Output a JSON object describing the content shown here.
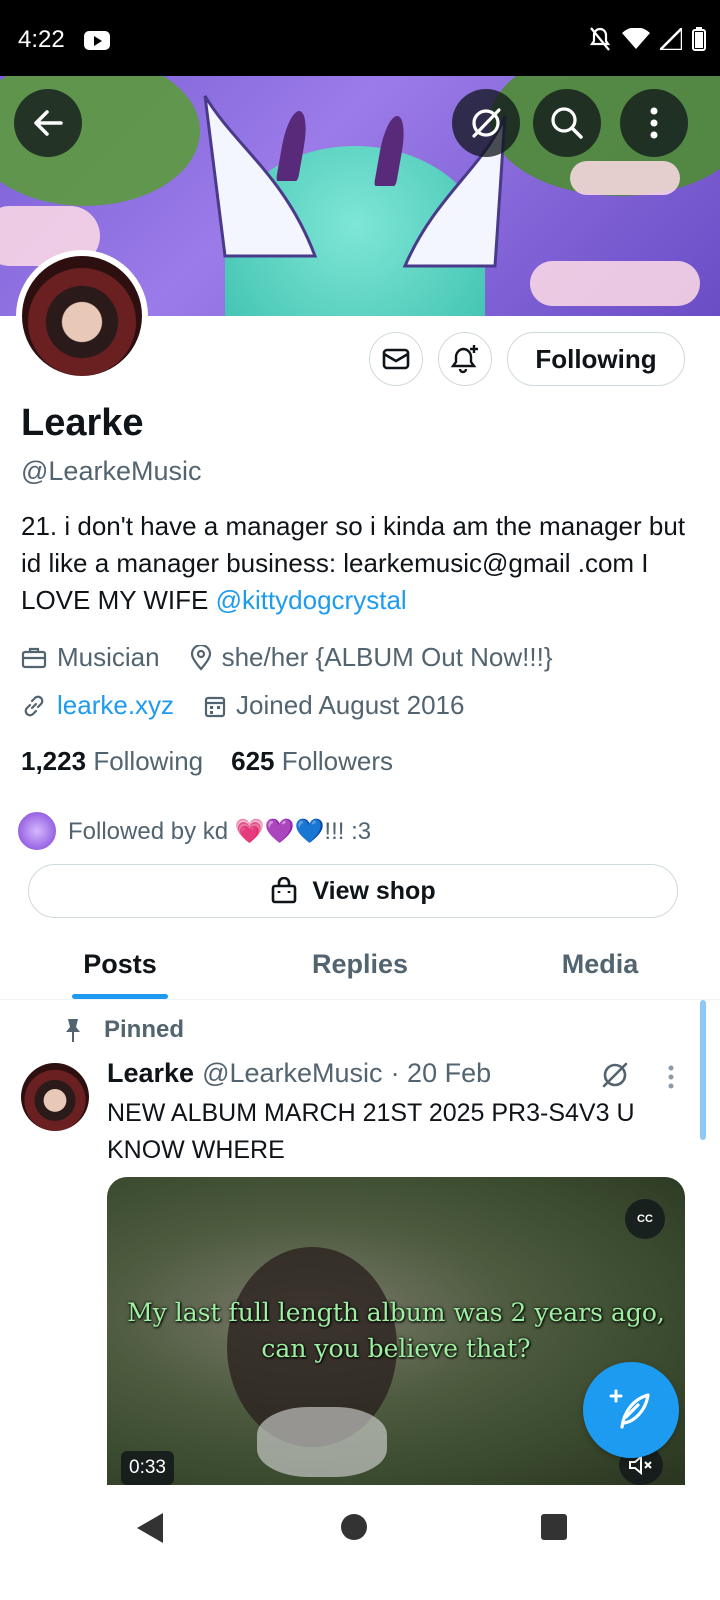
{
  "status_bar": {
    "time": "4:22"
  },
  "profile": {
    "name": "Learke",
    "handle": "@LearkeMusic",
    "bio_text": "21.  i don't have a manager so i kinda am the manager but id like a manager business: learkemusic@gmail .com I LOVE MY WIFE ",
    "bio_mention": "@kittydogcrystal",
    "category": "Musician",
    "location": "she/her {ALBUM Out Now!!!}",
    "website": "learke.xyz",
    "joined": "Joined August 2016",
    "following_count": "1,223",
    "following_label": "Following",
    "followers_count": "625",
    "followers_label": "Followers",
    "followed_by": "Followed by kd 💗💜💙!!! :3",
    "follow_button_label": "Following",
    "shop_button_label": "View shop"
  },
  "tabs": [
    {
      "label": "Posts",
      "active": true
    },
    {
      "label": "Replies",
      "active": false
    },
    {
      "label": "Media",
      "active": false
    }
  ],
  "pinned_post": {
    "pinned_label": "Pinned",
    "author_name": "Learke",
    "author_handle": "@LearkeMusic",
    "date": "· 20 Feb",
    "text": "NEW ALBUM MARCH 21ST 2025 PR3-S4V3 U KNOW WHERE",
    "video": {
      "caption_line1": "My last full length album was 2 years ago,",
      "caption_line2": "can you believe that?",
      "cc_label": "CC",
      "duration": "0:33"
    }
  },
  "colors": {
    "accent": "#1d9bf0",
    "text": "#0f1419",
    "secondary": "#536471"
  },
  "icons": [
    "back-arrow-icon",
    "grok-icon",
    "search-icon",
    "more-vertical-icon",
    "mail-icon",
    "bell-plus-icon",
    "briefcase-icon",
    "location-icon",
    "link-icon",
    "calendar-icon",
    "shopping-bag-icon",
    "pin-icon",
    "compose-icon"
  ]
}
